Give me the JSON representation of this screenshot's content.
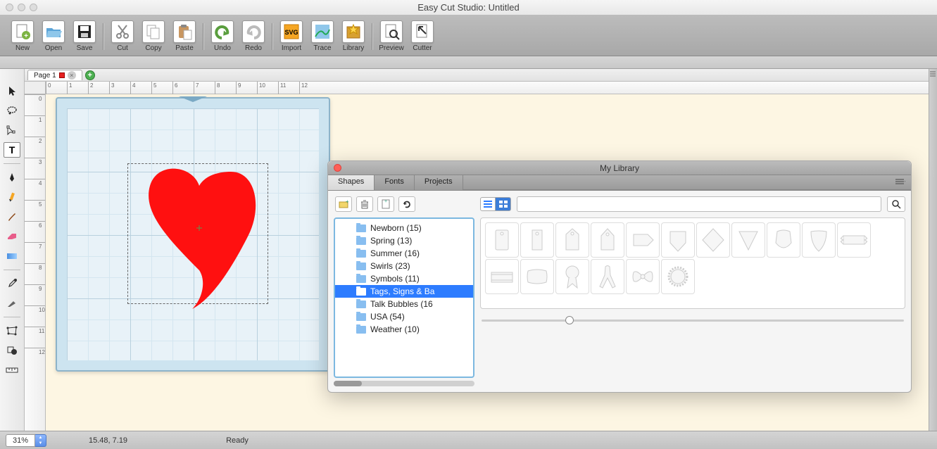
{
  "app": {
    "title": "Easy Cut Studio: Untitled"
  },
  "toolbar": [
    {
      "id": "new",
      "label": "New"
    },
    {
      "id": "open",
      "label": "Open"
    },
    {
      "id": "save",
      "label": "Save"
    },
    {
      "sep": true
    },
    {
      "id": "cut",
      "label": "Cut"
    },
    {
      "id": "copy",
      "label": "Copy"
    },
    {
      "id": "paste",
      "label": "Paste"
    },
    {
      "sep": true
    },
    {
      "id": "undo",
      "label": "Undo"
    },
    {
      "id": "redo",
      "label": "Redo"
    },
    {
      "sep": true
    },
    {
      "id": "import",
      "label": "Import"
    },
    {
      "id": "trace",
      "label": "Trace"
    },
    {
      "id": "library",
      "label": "Library"
    },
    {
      "sep": true
    },
    {
      "id": "preview",
      "label": "Preview"
    },
    {
      "id": "cutter",
      "label": "Cutter"
    }
  ],
  "page_tab": {
    "label": "Page 1"
  },
  "ruler": {
    "h": [
      "0",
      "1",
      "2",
      "3",
      "4",
      "5",
      "6",
      "7",
      "8",
      "9",
      "10",
      "11",
      "12"
    ],
    "v": [
      "0",
      "1",
      "2",
      "3",
      "4",
      "5",
      "6",
      "7",
      "8",
      "9",
      "10",
      "11",
      "12"
    ]
  },
  "library_panel": {
    "title": "My Library",
    "tabs": [
      "Shapes",
      "Fonts",
      "Projects"
    ],
    "active_tab": 0,
    "folders": [
      {
        "label": "Newborn (15)"
      },
      {
        "label": "Spring (13)"
      },
      {
        "label": "Summer (16)"
      },
      {
        "label": "Swirls (23)"
      },
      {
        "label": "Symbols (11)"
      },
      {
        "label": "Tags, Signs & Ba",
        "selected": true
      },
      {
        "label": "Talk Bubbles (16"
      },
      {
        "label": "USA (54)"
      },
      {
        "label": "Weather (10)"
      }
    ],
    "search_placeholder": "",
    "shape_icons": [
      "tag-rect",
      "tag-angle",
      "tag-point",
      "tag-point2",
      "label",
      "shield-down",
      "diamond",
      "triangle-down",
      "badge",
      "shield",
      "banner",
      "banner-rect",
      "pillow",
      "award-ribbon",
      "ribbon-awareness",
      "bow",
      "seal"
    ]
  },
  "statusbar": {
    "zoom": "31%",
    "coords": "15.48, 7.19",
    "status": "Ready"
  },
  "colors": {
    "heart": "#ff1010",
    "mat": "#cde4f0",
    "canvas_bg": "#fdf6e3",
    "selection": "#666666"
  }
}
